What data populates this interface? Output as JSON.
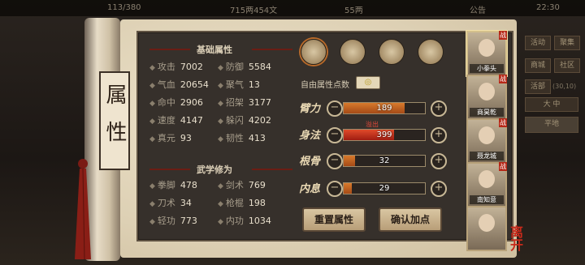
{
  "topbar": {
    "resource_a": "113/380",
    "resource_b": "715两454文",
    "resource_c": "55两",
    "announcement": "公告",
    "clock": "22:30"
  },
  "side_menu": {
    "items": [
      "活动",
      "聚集",
      "商城",
      "社区",
      "活部"
    ],
    "sub_counter": "(30,10)",
    "sub_label": "大 中",
    "flat_button": "平地"
  },
  "scroll": {
    "title": "属性"
  },
  "basic": {
    "heading": "基础属性",
    "stats": [
      {
        "label": "攻击",
        "value": "7002"
      },
      {
        "label": "防御",
        "value": "5584"
      },
      {
        "label": "气血",
        "value": "20654"
      },
      {
        "label": "聚气",
        "value": "13"
      },
      {
        "label": "命中",
        "value": "2906"
      },
      {
        "label": "招架",
        "value": "3177"
      },
      {
        "label": "速度",
        "value": "4147"
      },
      {
        "label": "躲闪",
        "value": "4202"
      },
      {
        "label": "真元",
        "value": "93"
      },
      {
        "label": "韧性",
        "value": "413"
      }
    ]
  },
  "martial": {
    "heading": "武学修为",
    "stats": [
      {
        "label": "拳脚",
        "value": "478"
      },
      {
        "label": "剑术",
        "value": "769"
      },
      {
        "label": "刀术",
        "value": "34"
      },
      {
        "label": "枪棍",
        "value": "198"
      },
      {
        "label": "轻功",
        "value": "773"
      },
      {
        "label": "内功",
        "value": "1034"
      }
    ]
  },
  "free_points": {
    "label": "自由属性点数",
    "value": "◎"
  },
  "attributes": [
    {
      "label": "臂力",
      "value": "189",
      "fill": 0.75,
      "over": false,
      "note": ""
    },
    {
      "label": "身法",
      "value": "399",
      "fill": 0.62,
      "over": true,
      "note": "溢出"
    },
    {
      "label": "根骨",
      "value": "32",
      "fill": 0.14,
      "over": false,
      "note": ""
    },
    {
      "label": "内息",
      "value": "29",
      "fill": 0.1,
      "over": false,
      "note": ""
    }
  ],
  "buttons": {
    "reset": "重置属性",
    "confirm": "确认加点"
  },
  "characters": [
    {
      "name": "小拳头",
      "badge": "战"
    },
    {
      "name": "商昊乾",
      "badge": "战"
    },
    {
      "name": "聂龙城",
      "badge": "战"
    },
    {
      "name": "南知意",
      "badge": "战"
    },
    {
      "name": "",
      "badge": ""
    }
  ],
  "leave": "离开",
  "colors": {
    "accent_orange": "#d77a2c",
    "overflow_red": "#e04a2a",
    "panel_bg": "#36302b"
  }
}
